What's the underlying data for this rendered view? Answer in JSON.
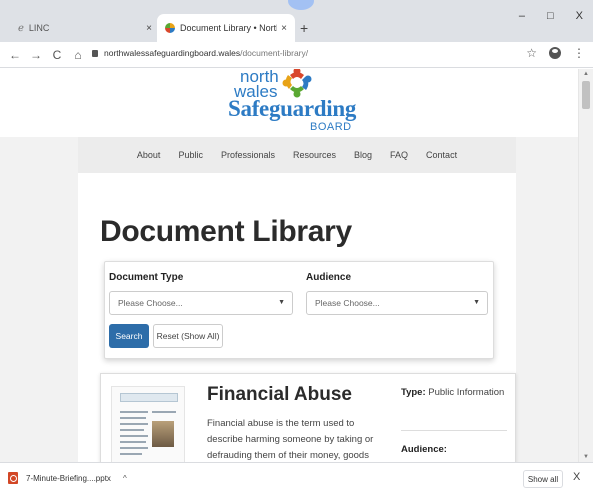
{
  "browser": {
    "tabs": [
      {
        "title": "LINC",
        "close": "×"
      },
      {
        "title": "Document Library • North Wales",
        "close": "×"
      }
    ],
    "new_tab": "+",
    "window_controls": {
      "minimize": "–",
      "maximize": "□",
      "close": "X"
    },
    "nav": {
      "back": "←",
      "forward": "→",
      "reload": "C",
      "home": "⌂"
    },
    "url_host": "northwalessafeguardingboard.wales",
    "url_path": "/document-library/",
    "bookmark": "☆",
    "menu": "⋮"
  },
  "site": {
    "logo": {
      "line1": "north",
      "line2": "wales",
      "line3": "Safeguarding",
      "line4": "BOARD"
    },
    "nav_items": [
      "About",
      "Public",
      "Professionals",
      "Resources",
      "Blog",
      "FAQ",
      "Contact"
    ]
  },
  "page": {
    "title": "Document Library",
    "filters": {
      "document_type_label": "Document Type",
      "document_type_value": "Please Choose...",
      "audience_label": "Audience",
      "audience_value": "Please Choose...",
      "search_label": "Search",
      "reset_label": "Reset (Show All)"
    },
    "document": {
      "title": "Financial Abuse",
      "description": "Financial abuse is the term used to describe harming someone by taking or defrauding them of their money, goods",
      "type_label": "Type:",
      "type_value": "Public Information",
      "audience_label": "Audience:"
    }
  },
  "downloads": {
    "file": "7-Minute-Briefing....pptx",
    "chevron": "^",
    "show_all": "Show all",
    "close": "X"
  },
  "colors": {
    "brand_blue": "#2d7bc4",
    "button_blue": "#2d6da9"
  }
}
